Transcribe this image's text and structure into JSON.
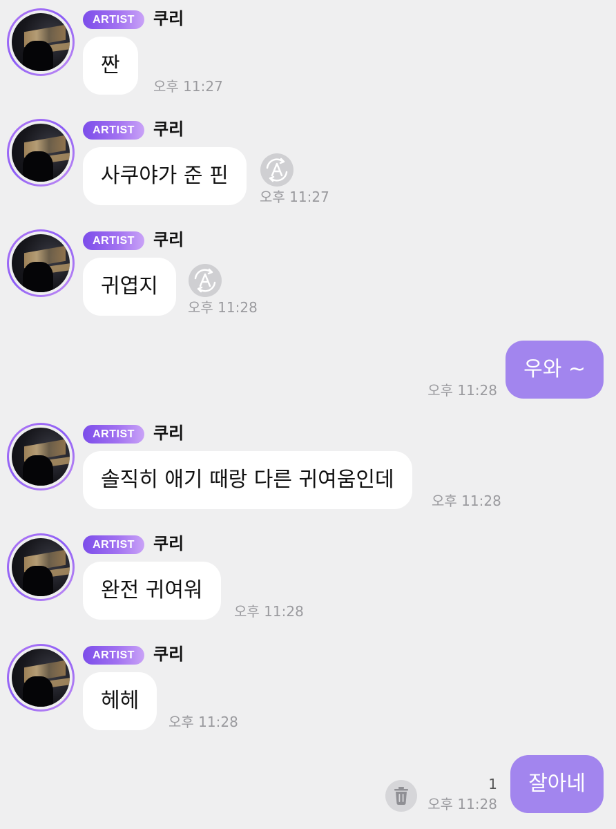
{
  "theme": {
    "artist_badge_gradient": [
      "#7c4dea",
      "#c9a2f7"
    ],
    "outgoing_bubble_color": "#a285ee",
    "incoming_bubble_color": "#ffffff",
    "background": "#efeff0"
  },
  "messages": [
    {
      "direction": "in",
      "badge": "ARTIST",
      "sender": "쿠리",
      "text": "짠",
      "time": "오후 11:27",
      "translate_icon": false
    },
    {
      "direction": "in",
      "badge": "ARTIST",
      "sender": "쿠리",
      "text": "사쿠야가 준 핀",
      "time": "오후 11:27",
      "translate_icon": true
    },
    {
      "direction": "in",
      "badge": "ARTIST",
      "sender": "쿠리",
      "text": "귀엽지",
      "time": "오후 11:28",
      "translate_icon": true
    },
    {
      "direction": "out",
      "text": "우와 ~",
      "time": "오후 11:28"
    },
    {
      "direction": "in",
      "badge": "ARTIST",
      "sender": "쿠리",
      "text": "솔직히 애기 때랑 다른 귀여움인데",
      "time": "오후 11:28",
      "translate_icon": false
    },
    {
      "direction": "in",
      "badge": "ARTIST",
      "sender": "쿠리",
      "text": "완전 귀여워",
      "time": "오후 11:28",
      "translate_icon": false
    },
    {
      "direction": "in",
      "badge": "ARTIST",
      "sender": "쿠리",
      "text": "헤헤",
      "time": "오후 11:28",
      "translate_icon": false
    },
    {
      "direction": "out",
      "text": "잘아네",
      "time": "오후 11:28",
      "unread_count": "1",
      "delete_icon": true
    }
  ]
}
